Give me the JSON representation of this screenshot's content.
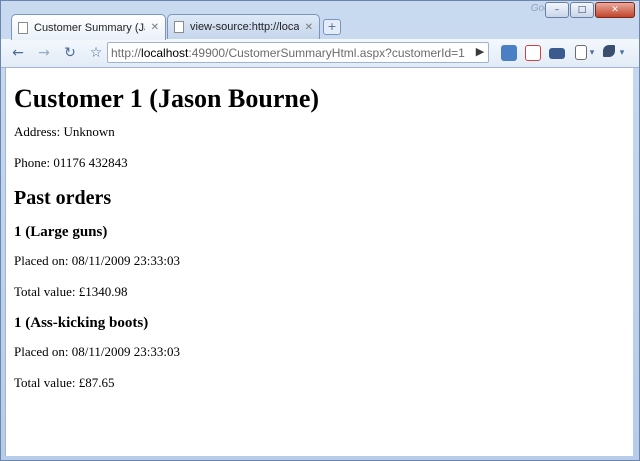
{
  "browser": {
    "brand": "Google",
    "controls": {
      "minimize": "–",
      "maximize": "□",
      "close": "✕"
    },
    "tabs": [
      {
        "label": "Customer Summary (Jas...",
        "close": "✕",
        "active": true
      },
      {
        "label": "view-source:http://localh...",
        "close": "✕",
        "active": false
      }
    ],
    "new_tab_label": "+",
    "nav": {
      "back": "←",
      "forward": "→",
      "reload": "↻",
      "star": "☆",
      "go": "▶"
    },
    "address": {
      "scheme": "http://",
      "host": "localhost",
      "rest": ":49900/CustomerSummaryHtml.aspx?customerId=1"
    },
    "extensions": {
      "page_menu": "▾",
      "wrench_menu": "▾"
    }
  },
  "page": {
    "title": "Customer 1 (Jason Bourne)",
    "address_line": "Address: Unknown",
    "phone_line": "Phone: 01176 432843",
    "orders_heading": "Past orders",
    "orders": [
      {
        "heading": "1 (Large guns)",
        "placed": "Placed on: 08/11/2009 23:33:03",
        "total": "Total value: £1340.98"
      },
      {
        "heading": "1 (Ass-kicking boots)",
        "placed": "Placed on: 08/11/2009 23:33:03",
        "total": "Total value: £87.65"
      }
    ]
  }
}
